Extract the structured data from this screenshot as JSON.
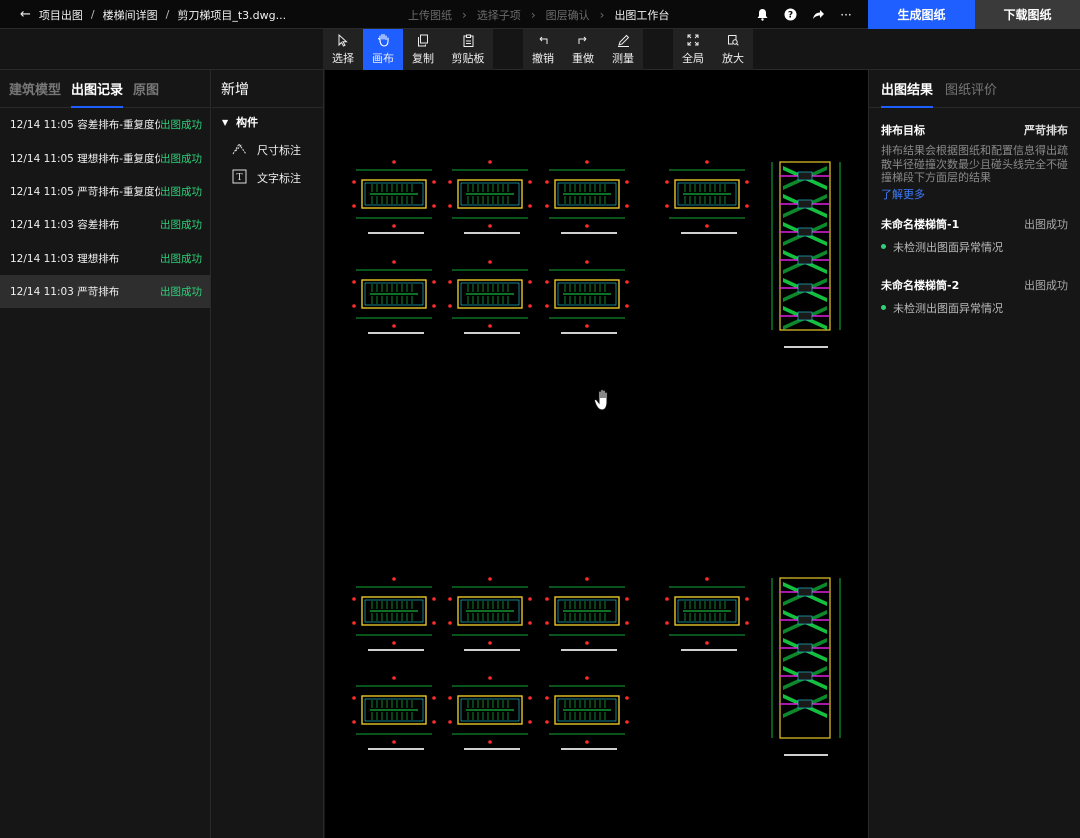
{
  "topbar": {
    "breadcrumbs": [
      "项目出图",
      "楼梯间详图",
      "剪刀梯项目_t3.dwg..."
    ],
    "steps": [
      "上传图纸",
      "选择子项",
      "图层确认",
      "出图工作台"
    ],
    "current_step": "出图工作台",
    "icons": [
      "bell-icon",
      "help-icon",
      "share-icon",
      "more-icon"
    ],
    "generate_label": "生成图纸",
    "download_label": "下载图纸"
  },
  "toolbar": {
    "select": "选择",
    "canvas": "画布",
    "copy": "复制",
    "clipboard": "剪贴板",
    "undo": "撤销",
    "redo": "重做",
    "measure": "测量",
    "fit": "全局",
    "zoom": "放大"
  },
  "left": {
    "tabs": [
      "建筑模型",
      "出图记录",
      "原图"
    ],
    "active_tab": "出图记录",
    "records": [
      {
        "time": "12/14 11:05",
        "name": "容差排布-重复度优先",
        "status": "出图成功"
      },
      {
        "time": "12/14 11:05",
        "name": "理想排布-重复度优先",
        "status": "出图成功"
      },
      {
        "time": "12/14 11:05",
        "name": "严苛排布-重复度优先",
        "status": "出图成功"
      },
      {
        "time": "12/14 11:03",
        "name": "容差排布",
        "status": "出图成功"
      },
      {
        "time": "12/14 11:03",
        "name": "理想排布",
        "status": "出图成功"
      },
      {
        "time": "12/14 11:03",
        "name": "严苛排布",
        "status": "出图成功"
      }
    ]
  },
  "components": {
    "title": "新增",
    "group": "构件",
    "items": [
      "尺寸标注",
      "文字标注"
    ]
  },
  "right": {
    "tabs": [
      "出图结果",
      "图纸评价"
    ],
    "active_tab": "出图结果",
    "target_label": "排布目标",
    "target_value": "严苛排布",
    "description": "排布结果会根据图纸和配置信息得出疏散半径碰撞次数最少且碰头线完全不碰撞梯段下方面层的结果",
    "learn_more": "了解更多",
    "results": [
      {
        "name": "未命名楼梯筒-1",
        "status": "出图成功",
        "note": "未检测出图面异常情况"
      },
      {
        "name": "未命名楼梯筒-2",
        "status": "出图成功",
        "note": "未检测出图面异常情况"
      }
    ]
  },
  "colors": {
    "accent": "#1f5fff",
    "success": "#2fd07a",
    "cad_green": "#18e04a",
    "cad_yellow": "#e8c62a",
    "cad_cyan": "#23d6e6",
    "cad_magenta": "#e021e0",
    "cad_red": "#ff2b2b"
  }
}
